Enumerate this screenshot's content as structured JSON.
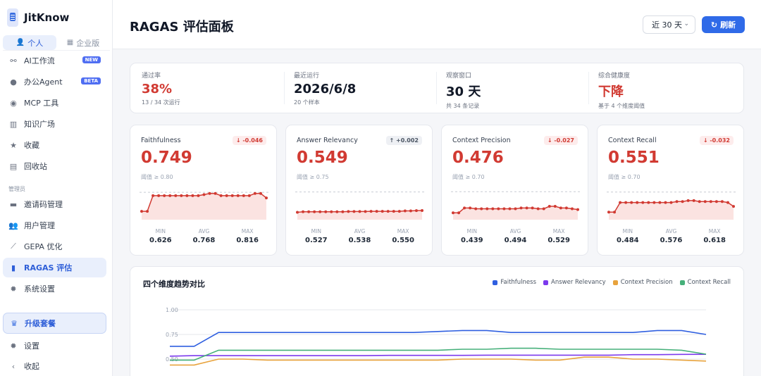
{
  "brand": {
    "name": "JitKnow"
  },
  "mode_tabs": [
    {
      "label": "个人",
      "icon": "person-icon",
      "active": true
    },
    {
      "label": "企业版",
      "icon": "building-icon",
      "active": false
    }
  ],
  "nav": {
    "items": [
      {
        "label": "AI工作流",
        "icon": "workflow-icon",
        "badge": "NEW"
      },
      {
        "label": "办公Agent",
        "icon": "agent-icon",
        "badge": "BETA"
      },
      {
        "label": "MCP 工具",
        "icon": "tool-icon"
      },
      {
        "label": "知识广场",
        "icon": "library-icon"
      },
      {
        "label": "收藏",
        "icon": "star-icon"
      },
      {
        "label": "回收站",
        "icon": "trash-icon"
      }
    ],
    "admin_label": "管理员",
    "admin_items": [
      {
        "label": "邀请码管理",
        "icon": "ticket-icon"
      },
      {
        "label": "用户管理",
        "icon": "users-icon"
      },
      {
        "label": "GEPA 优化",
        "icon": "wand-icon"
      },
      {
        "label": "RAGAS 评估",
        "icon": "chart-icon",
        "active": true
      },
      {
        "label": "系统设置",
        "icon": "gear-icon"
      }
    ],
    "upgrade_label": "升级套餐",
    "bottom_items": [
      {
        "label": "设置",
        "icon": "settings-icon"
      },
      {
        "label": "收起",
        "icon": "chevron-left-icon"
      }
    ]
  },
  "header": {
    "title": "RAGAS 评估面板",
    "range_value": "近 30 天",
    "refresh_label": "刷新"
  },
  "summary": [
    {
      "label": "通过率",
      "value": "38%",
      "sub": "13 / 34 次运行",
      "red": true
    },
    {
      "label": "最近运行",
      "value": "2026/6/8",
      "sub": "20 个样本",
      "red": false
    },
    {
      "label": "观察窗口",
      "value": "30 天",
      "sub": "共 34 条记录",
      "red": false
    },
    {
      "label": "综合健康度",
      "value": "下降",
      "sub": "基于 4 个维度阈值",
      "red": true
    }
  ],
  "metrics": [
    {
      "name": "Faithfulness",
      "delta": "↓ -0.046",
      "direction": "down",
      "value": "0.749",
      "threshold_text": "阈值 ≥ 0.80",
      "threshold": 0.8,
      "min": "0.626",
      "avg": "0.768",
      "max": "0.816",
      "series": [
        0.63,
        0.63,
        0.77,
        0.77,
        0.77,
        0.77,
        0.77,
        0.77,
        0.77,
        0.77,
        0.77,
        0.78,
        0.79,
        0.79,
        0.77,
        0.77,
        0.77,
        0.77,
        0.77,
        0.77,
        0.79,
        0.79,
        0.75
      ]
    },
    {
      "name": "Answer Relevancy",
      "delta": "↑ +0.002",
      "direction": "up",
      "value": "0.549",
      "threshold_text": "阈值 ≥ 0.75",
      "threshold": 0.75,
      "min": "0.527",
      "avg": "0.538",
      "max": "0.550",
      "series": [
        0.53,
        0.535,
        0.535,
        0.535,
        0.535,
        0.535,
        0.535,
        0.535,
        0.535,
        0.538,
        0.538,
        0.538,
        0.538,
        0.54,
        0.54,
        0.54,
        0.54,
        0.54,
        0.54,
        0.545,
        0.545,
        0.548,
        0.549
      ]
    },
    {
      "name": "Context Precision",
      "delta": "↓ -0.027",
      "direction": "down",
      "value": "0.476",
      "threshold_text": "阈值 ≥ 0.70",
      "threshold": 0.7,
      "min": "0.439",
      "avg": "0.494",
      "max": "0.529",
      "series": [
        0.44,
        0.44,
        0.5,
        0.5,
        0.49,
        0.49,
        0.49,
        0.49,
        0.49,
        0.49,
        0.49,
        0.49,
        0.5,
        0.5,
        0.5,
        0.49,
        0.49,
        0.52,
        0.52,
        0.5,
        0.5,
        0.49,
        0.48
      ]
    },
    {
      "name": "Context Recall",
      "delta": "↓ -0.032",
      "direction": "down",
      "value": "0.551",
      "threshold_text": "阈值 ≥ 0.70",
      "threshold": 0.7,
      "min": "0.484",
      "avg": "0.576",
      "max": "0.618",
      "series": [
        0.49,
        0.49,
        0.59,
        0.59,
        0.59,
        0.59,
        0.59,
        0.59,
        0.59,
        0.59,
        0.59,
        0.59,
        0.6,
        0.6,
        0.61,
        0.61,
        0.6,
        0.6,
        0.6,
        0.6,
        0.6,
        0.59,
        0.55
      ]
    }
  ],
  "colors": {
    "accent": "#2f6ae8",
    "danger": "#d13a32",
    "faithfulness": "#2f5fe0",
    "answer_relevancy": "#7c3aed",
    "context_precision": "#e8a33d",
    "context_recall": "#46b07a"
  },
  "trend": {
    "title": "四个维度趋势对比",
    "chart_data": {
      "type": "line",
      "y_ticks": [
        "1.00",
        "0.75",
        "0.50"
      ],
      "ylim": [
        0.5,
        1.0
      ],
      "grid": true,
      "legend_position": "top-right",
      "x": [
        1,
        2,
        3,
        4,
        5,
        6,
        7,
        8,
        9,
        10,
        11,
        12,
        13,
        14,
        15,
        16,
        17,
        18,
        19,
        20,
        21,
        22,
        23
      ],
      "series": [
        {
          "name": "Faithfulness",
          "color": "#2f5fe0",
          "values": [
            0.63,
            0.63,
            0.77,
            0.77,
            0.77,
            0.77,
            0.77,
            0.77,
            0.77,
            0.77,
            0.77,
            0.78,
            0.79,
            0.79,
            0.77,
            0.77,
            0.77,
            0.77,
            0.77,
            0.77,
            0.79,
            0.79,
            0.75
          ]
        },
        {
          "name": "Answer Relevancy",
          "color": "#7c3aed",
          "values": [
            0.53,
            0.535,
            0.535,
            0.535,
            0.535,
            0.535,
            0.535,
            0.535,
            0.535,
            0.538,
            0.538,
            0.538,
            0.538,
            0.54,
            0.54,
            0.54,
            0.54,
            0.54,
            0.54,
            0.545,
            0.545,
            0.548,
            0.549
          ]
        },
        {
          "name": "Context Precision",
          "color": "#e8a33d",
          "values": [
            0.44,
            0.44,
            0.5,
            0.5,
            0.49,
            0.49,
            0.49,
            0.49,
            0.49,
            0.49,
            0.49,
            0.49,
            0.5,
            0.5,
            0.5,
            0.49,
            0.49,
            0.52,
            0.52,
            0.5,
            0.5,
            0.49,
            0.48
          ]
        },
        {
          "name": "Context Recall",
          "color": "#46b07a",
          "values": [
            0.49,
            0.49,
            0.59,
            0.59,
            0.59,
            0.59,
            0.59,
            0.59,
            0.59,
            0.59,
            0.59,
            0.59,
            0.6,
            0.6,
            0.61,
            0.61,
            0.6,
            0.6,
            0.6,
            0.6,
            0.6,
            0.59,
            0.55
          ]
        }
      ]
    }
  }
}
